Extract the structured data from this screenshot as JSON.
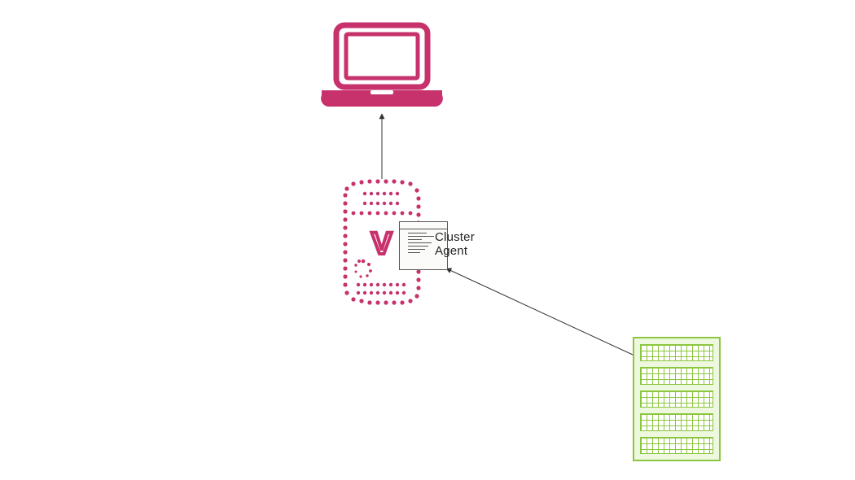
{
  "labels": {
    "agent_line1": "Cluster",
    "agent_line2": "Agent"
  },
  "icons": {
    "laptop": "laptop-icon",
    "vserver": "virtual-server-icon",
    "agent": "script-window-icon",
    "rack": "server-rack-icon"
  },
  "colors": {
    "laptop": "#c7316c",
    "vserver": "#c7316c",
    "rack": "#8cc63f",
    "connector": "#333333"
  },
  "connections": [
    {
      "from": "vserver",
      "to": "laptop",
      "direction": "to"
    },
    {
      "from": "rack",
      "to": "agent",
      "direction": "to"
    }
  ]
}
